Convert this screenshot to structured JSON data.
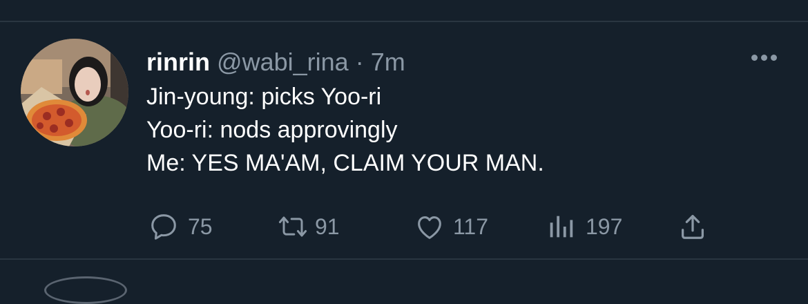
{
  "tweet": {
    "display_name": "rinrin",
    "handle": "@wabi_rina",
    "separator": "·",
    "time": "7m",
    "lines": [
      "Jin-young: picks Yoo-ri",
      "Yoo-ri: nods approvingly",
      "Me: YES MA'AM, CLAIM YOUR MAN."
    ],
    "stats": {
      "replies": "75",
      "retweets": "91",
      "likes": "117",
      "views": "197"
    }
  },
  "icons": {
    "reply": "reply-icon",
    "retweet": "retweet-icon",
    "like": "heart-icon",
    "views": "analytics-icon",
    "share": "share-icon",
    "more": "more-options-icon"
  },
  "colors": {
    "background": "#15202b",
    "text": "#ffffff",
    "secondary_text": "#8b98a5",
    "divider": "#2a3641"
  }
}
